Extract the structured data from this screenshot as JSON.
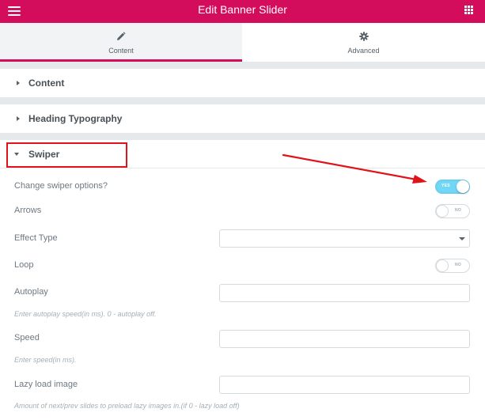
{
  "header": {
    "title": "Edit Banner Slider",
    "background": "#d30c5c"
  },
  "tabs": [
    {
      "label": "Content",
      "icon": "pencil-icon",
      "active": true
    },
    {
      "label": "Advanced",
      "icon": "gear-icon",
      "active": false
    }
  ],
  "sections": {
    "content": {
      "title": "Content",
      "expanded": false
    },
    "heading_typography": {
      "title": "Heading Typography",
      "expanded": false
    },
    "swiper": {
      "title": "Swiper",
      "expanded": true
    }
  },
  "controls": {
    "change_swiper": {
      "label": "Change swiper options?",
      "toggle_text": "YES",
      "value": true
    },
    "arrows": {
      "label": "Arrows",
      "toggle_text": "NO",
      "value": false
    },
    "effect_type": {
      "label": "Effect Type",
      "value": ""
    },
    "loop": {
      "label": "Loop",
      "toggle_text": "NO",
      "value": false
    },
    "autoplay": {
      "label": "Autoplay",
      "value": "",
      "description": "Enter autoplay speed(in ms). 0 - autoplay off."
    },
    "speed": {
      "label": "Speed",
      "value": "",
      "description": "Enter speed(in ms)."
    },
    "lazy_load": {
      "label": "Lazy load image",
      "value": "",
      "description": "Amount of next/prev slides to preload lazy images in.(if 0 - lazy load off)"
    }
  },
  "annotations": {
    "highlight_color": "#e1131a",
    "arrow_color": "#e1131a"
  }
}
